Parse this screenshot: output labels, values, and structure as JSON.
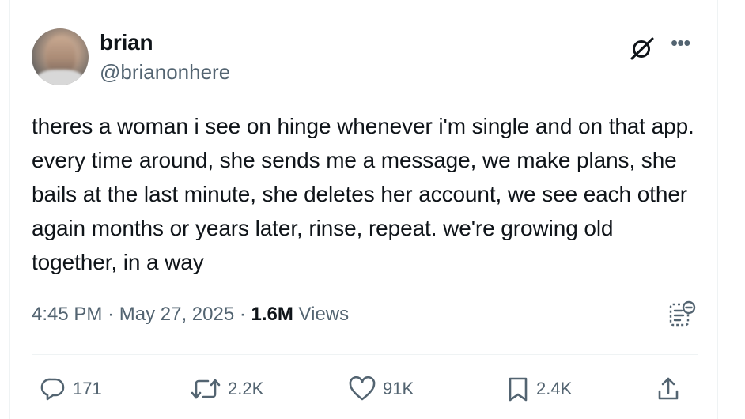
{
  "author": {
    "display_name": "brian",
    "handle": "@brianonhere"
  },
  "tweet": {
    "text": "theres a woman i see on hinge whenever i'm single and on that app. every time around, she sends me a message, we make plans, she bails at the last minute, she deletes her account, we see each other again months or years later, rinse, repeat. we're growing old together, in a way",
    "time": "4:45 PM",
    "separator": "·",
    "date": "May 27, 2025",
    "views_count": "1.6M",
    "views_label": "Views"
  },
  "actions": {
    "replies": "171",
    "reposts": "2.2K",
    "likes": "91K",
    "bookmarks": "2.4K"
  },
  "icons": {
    "grok": "grok-icon",
    "more": "more-icon",
    "analytics": "analytics-icon",
    "reply": "reply-icon",
    "repost": "repost-icon",
    "like": "heart-icon",
    "bookmark": "bookmark-icon",
    "share": "share-icon"
  },
  "colors": {
    "text_primary": "#0f1419",
    "text_secondary": "#536471",
    "divider": "#eff3f4"
  }
}
